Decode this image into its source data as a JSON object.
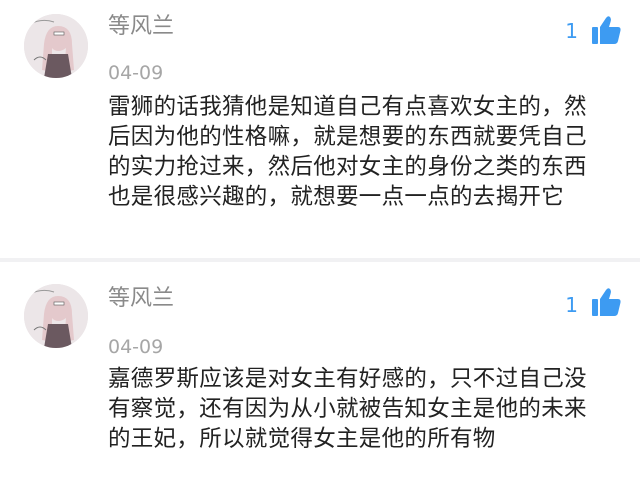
{
  "comments": [
    {
      "username": "等风兰",
      "date": "04-09",
      "like_count": "1",
      "like_icon": "thumbs-up-icon",
      "text": "雷狮的话我猜他是知道自己有点喜欢女主的，然后因为他的性格嘛，就是想要的东西就要凭自己的实力抢过来，然后他对女主的身份之类的东西也是很感兴趣的，就想要一点一点的去揭开它"
    },
    {
      "username": "等风兰",
      "date": "04-09",
      "like_count": "1",
      "like_icon": "thumbs-up-icon",
      "text": "嘉德罗斯应该是对女主有好感的，只不过自己没有察觉，还有因为从小就被告知女主是他的未来的王妃，所以就觉得女主是他的所有物"
    }
  ],
  "colors": {
    "like_blue": "#3d9bf2",
    "username_gray": "#8a8a8a",
    "body_text": "#222222"
  }
}
